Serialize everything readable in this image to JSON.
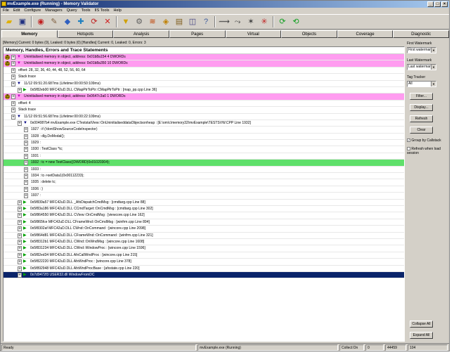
{
  "window": {
    "title": "mvExample.exe (Running) - Memory Validator"
  },
  "menu": [
    "File",
    "Edit",
    "Configure",
    "Managers",
    "Query",
    "Tools",
    "IIS Tools",
    "Help"
  ],
  "toolbar_icons": [
    "open-folder-icon",
    "save-icon",
    "launch-icon",
    "inject-icon",
    "monitor-icon",
    "wait-icon",
    "restart-icon",
    "stop-icon",
    "filter-icon",
    "settings-icon",
    "watermark-icon",
    "tag-icon",
    "clear-icon",
    "snapshot-icon",
    "help-icon",
    "record-icon",
    "play-icon",
    "refresh-icon",
    "compare-icon",
    "green-refresh-icon",
    "green-refresh-alt-icon"
  ],
  "tabs": [
    "Memory",
    "Hotspots",
    "Analysis",
    "Pages",
    "Virtual",
    "Objects",
    "Coverage",
    "Diagnostic"
  ],
  "status_line": "[Memory] Current: 0 bytes (0), Leaked: 0 bytes (0) [Handles] Current: 0, Leaked: 0, Errors: 3",
  "panel_title": "Memory, Handles, Errors and Trace Statements",
  "rows": [
    {
      "indent": 0,
      "icons": [
        "warn",
        "exp",
        "tri-p"
      ],
      "style": "pink",
      "text": "Uninitialised memory in object, address: 0x01b8a154 4 DWORDs"
    },
    {
      "indent": 0,
      "icons": [
        "warn",
        "exp",
        "tri-p"
      ],
      "style": "pink",
      "text": "Uninitialised memory in object, address: 0x01b8a350 10 DWORDs"
    },
    {
      "indent": 1,
      "icons": [
        "exp"
      ],
      "style": "",
      "text": "offset: 28, 32, 36, 40, 44, 48, 52, 56, 60, 64"
    },
    {
      "indent": 1,
      "icons": [
        "exp"
      ],
      "style": "",
      "text": "Stack trace"
    },
    {
      "indent": 1,
      "icons": [
        "exp",
        "tri-b"
      ],
      "style": "",
      "text": "11/12 09:51:20.687ms (Lifetime:00:00:50:109ms)"
    },
    {
      "indent": 2,
      "icons": [
        "exp",
        "tri-g"
      ],
      "style": "",
      "text": "0x5f82eb00 MFC42uD.DLL CMapPtrToPtr::CMapPtrToPtr : [map_pp.cpp Line 36]"
    },
    {
      "indent": 0,
      "icons": [
        "warn",
        "exp",
        "tri-p"
      ],
      "style": "pink",
      "text": "Uninitialised memory in object, address: 0x0647c3a0 1 DWORDs"
    },
    {
      "indent": 1,
      "icons": [
        "exp"
      ],
      "style": "",
      "text": "offset: 4"
    },
    {
      "indent": 1,
      "icons": [
        "exp"
      ],
      "style": "",
      "text": "Stack trace"
    },
    {
      "indent": 1,
      "icons": [
        "exp",
        "tri-b"
      ],
      "style": "",
      "text": "11/12 09:51:56.687ms (Lifetime:00:00:22:109ms)"
    },
    {
      "indent": 2,
      "icons": [
        "exp",
        "tri-b"
      ],
      "style": "",
      "text": "0x004087b4 mvExample.exe CTeststatView::OnUninitialiseddataObjectsonheap : [E:\\om\\c\\memory32\\mvExample\\TESTSVW.CPP Line 1932]"
    },
    {
      "indent": 3,
      "icons": [
        "exp"
      ],
      "style": "",
      "text": "1927 :    if (!dontShowSourceCodeInspector)"
    },
    {
      "indent": 3,
      "icons": [
        "exp"
      ],
      "style": "",
      "text": "1928 :       dlg.DoModal();"
    },
    {
      "indent": 3,
      "icons": [
        "exp"
      ],
      "style": "",
      "text": "1929 :"
    },
    {
      "indent": 3,
      "icons": [
        "exp"
      ],
      "style": "",
      "text": "1930 :    TestClass  *tc;"
    },
    {
      "indent": 3,
      "icons": [
        "exp"
      ],
      "style": "",
      "text": "1931 :"
    },
    {
      "indent": 3,
      "icons": [
        "exp"
      ],
      "style": "green",
      "text": "1932 :    tc = new TestClass((DWORD)0x01020304);"
    },
    {
      "indent": 3,
      "icons": [
        "exp"
      ],
      "style": "",
      "text": "1933 :"
    },
    {
      "indent": 3,
      "icons": [
        "exp"
      ],
      "style": "",
      "text": "1934 :    tc->setData1(0x00112233);"
    },
    {
      "indent": 3,
      "icons": [
        "exp"
      ],
      "style": "",
      "text": "1935 :    delete tc;"
    },
    {
      "indent": 3,
      "icons": [
        "exp"
      ],
      "style": "",
      "text": "1936 : }"
    },
    {
      "indent": 3,
      "icons": [
        "exp"
      ],
      "style": "",
      "text": "1937 :"
    },
    {
      "indent": 2,
      "icons": [
        "exp",
        "tri-g"
      ],
      "style": "",
      "text": "0x5f839a57 MFC42uD.DLL _AfxDispatchCmdMsg : [cmdtarg.cpp Line 88]"
    },
    {
      "indent": 2,
      "icons": [
        "exp",
        "tri-g"
      ],
      "style": "",
      "text": "0x5f83a186 MFC42uD.DLL CCmdTarget::OnCmdMsg : [cmdtarg.cpp Line 302]"
    },
    {
      "indent": 2,
      "icons": [
        "exp",
        "tri-g"
      ],
      "style": "",
      "text": "0x5f864550 MFC42uD.DLL CView::OnCmdMsg : [viewcore.cpp Line 162]"
    },
    {
      "indent": 2,
      "icons": [
        "exp",
        "tri-g"
      ],
      "style": "",
      "text": "0x5f865fce MFC42uD.DLL CFrameWnd::OnCmdMsg : [winfrm.cpp Line 894]"
    },
    {
      "indent": 2,
      "icons": [
        "exp",
        "tri-g"
      ],
      "style": "",
      "text": "0x5f8302af MFC42uD.DLL CWnd::OnCommand : [wincore.cpp Line 2098]"
    },
    {
      "indent": 2,
      "icons": [
        "exp",
        "tri-g"
      ],
      "style": "",
      "text": "0x5f864d81 MFC42uD.DLL CFrameWnd::OnCommand : [winfrm.cpp Line 321]"
    },
    {
      "indent": 2,
      "icons": [
        "exp",
        "tri-g"
      ],
      "style": "",
      "text": "0x5f8312b1 MFC42uD.DLL CWnd::OnWndMsg : [wincore.cpp Line 1608]"
    },
    {
      "indent": 2,
      "icons": [
        "exp",
        "tri-g"
      ],
      "style": "",
      "text": "0x5f831234 MFC42uD.DLL CWnd::WindowProc : [wincore.cpp Line 1596]"
    },
    {
      "indent": 2,
      "icons": [
        "exp",
        "tri-g"
      ],
      "style": "",
      "text": "0x5f82ed34 MFC42uD.DLL AfxCallWndProc : [wincore.cpp Line 215]"
    },
    {
      "indent": 2,
      "icons": [
        "exp",
        "tri-g"
      ],
      "style": "",
      "text": "0x5f822220 MFC42uD.DLL AfxWndProc : [wincore.cpp Line 378]"
    },
    {
      "indent": 2,
      "icons": [
        "exp",
        "tri-g"
      ],
      "style": "",
      "text": "0x5f892948 MFC42uD.DLL AfxWndProcBase : [afxstate.cpp Line 220]"
    },
    {
      "indent": 2,
      "icons": [
        "exp",
        "tri-g"
      ],
      "style": "sel",
      "text": "0x7d9472f3 USER32.dll WindowFromDC"
    }
  ],
  "right_panel": {
    "first_watermark_label": "First Watermark",
    "first_watermark_value": "First watermark",
    "last_watermark_label": "Last Watermark",
    "last_watermark_value": "Last watermark",
    "tag_tracker_label": "Tag Tracker",
    "tag_tracker_value": "All",
    "filter_btn": "Filter...",
    "display_btn": "Display...",
    "refresh_btn": "Refresh",
    "clear_btn": "Clear",
    "group_by_callstack": "Group by Callstack",
    "refresh_when_load": "Refresh when load session",
    "collapse_all": "Collapse All",
    "expand_all": "Expand All"
  },
  "statusbar": {
    "ready": "Ready",
    "process": "mvExample.exe (Running)",
    "collect": "Collect:On",
    "zero": "0",
    "count1": "44459",
    "count2": "104"
  }
}
